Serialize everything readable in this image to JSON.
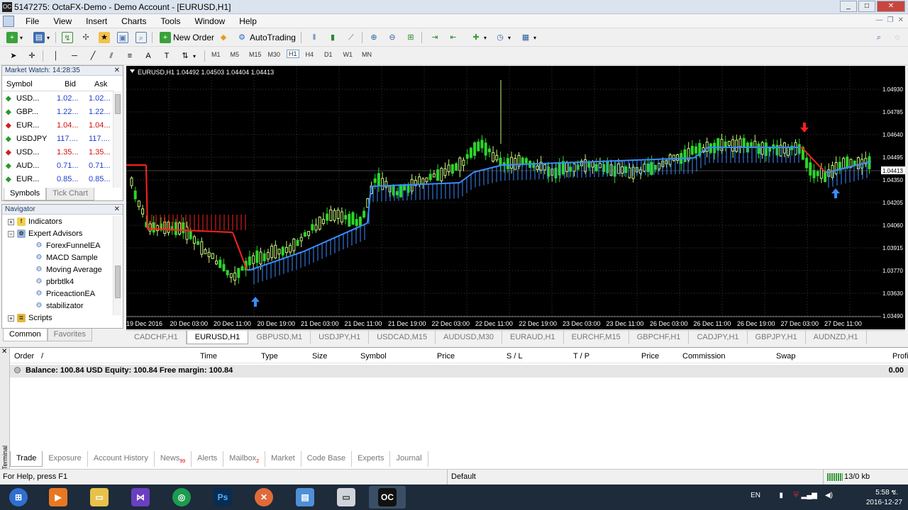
{
  "window": {
    "title": "5147275: OctaFX-Demo - Demo Account - [EURUSD,H1]",
    "app_icon": "OC",
    "min": "_",
    "max": "□",
    "close": "✕"
  },
  "menu": [
    "File",
    "View",
    "Insert",
    "Charts",
    "Tools",
    "Window",
    "Help"
  ],
  "toolbar": {
    "new_order": "New Order",
    "autotrading": "AutoTrading"
  },
  "timeframes": [
    "M1",
    "M5",
    "M15",
    "M30",
    "H1",
    "H4",
    "D1",
    "W1",
    "MN"
  ],
  "active_timeframe": "H1",
  "market_watch": {
    "title": "Market Watch: 14:28:35",
    "headers": [
      "Symbol",
      "Bid",
      "Ask"
    ],
    "rows": [
      {
        "dir": "up",
        "symbol": "USD...",
        "bid": "1.02...",
        "ask": "1.02...",
        "color": "#1f3fd0"
      },
      {
        "dir": "up",
        "symbol": "GBP...",
        "bid": "1.22...",
        "ask": "1.22...",
        "color": "#1f3fd0"
      },
      {
        "dir": "down",
        "symbol": "EUR...",
        "bid": "1.04...",
        "ask": "1.04...",
        "color": "#d01010"
      },
      {
        "dir": "up",
        "symbol": "USDJPY",
        "bid": "117....",
        "ask": "117....",
        "color": "#1f3fd0"
      },
      {
        "dir": "down",
        "symbol": "USD...",
        "bid": "1.35...",
        "ask": "1.35...",
        "color": "#d01010"
      },
      {
        "dir": "up",
        "symbol": "AUD...",
        "bid": "0.71...",
        "ask": "0.71...",
        "color": "#1f3fd0"
      },
      {
        "dir": "up",
        "symbol": "EUR...",
        "bid": "0.85...",
        "ask": "0.85...",
        "color": "#1f3fd0"
      }
    ],
    "tabs": [
      "Symbols",
      "Tick Chart"
    ]
  },
  "navigator": {
    "title": "Navigator",
    "items": [
      "Indicators",
      "Expert Advisors",
      "ForexFunnelEA",
      "MACD Sample",
      "Moving Average",
      "pbrbtlk4",
      "PriceactionEA",
      "stabilizator",
      "Scripts"
    ],
    "tabs": [
      "Common",
      "Favorites"
    ]
  },
  "chart": {
    "header": "EURUSD,H1  1.04492 1.04503 1.04404 1.04413",
    "price_labels": [
      "1.04930",
      "1.04785",
      "1.04640",
      "1.04495",
      "1.04413",
      "1.04350",
      "1.04205",
      "1.04060",
      "1.03915",
      "1.03770",
      "1.03630",
      "1.03490"
    ],
    "time_labels": [
      "19 Dec 2016",
      "20 Dec 03:00",
      "20 Dec 11:00",
      "20 Dec 19:00",
      "21 Dec 03:00",
      "21 Dec 11:00",
      "21 Dec 19:00",
      "22 Dec 03:00",
      "22 Dec 11:00",
      "22 Dec 19:00",
      "23 Dec 03:00",
      "23 Dec 11:00",
      "26 Dec 03:00",
      "26 Dec 11:00",
      "26 Dec 19:00",
      "27 Dec 03:00",
      "27 Dec 11:00"
    ]
  },
  "chart_tabs": [
    "CADCHF,H1",
    "EURUSD,H1",
    "GBPUSD,M1",
    "USDJPY,H1",
    "USDCAD,M15",
    "AUDUSD,M30",
    "EURAUD,H1",
    "EURCHF,M15",
    "GBPCHF,H1",
    "CADJPY,H1",
    "GBPJPY,H1",
    "AUDNZD,H1"
  ],
  "active_chart_tab": "EURUSD,H1",
  "terminal": {
    "side_label": "Terminal",
    "columns": [
      "Order",
      "/",
      "Time",
      "Type",
      "Size",
      "Symbol",
      "Price",
      "S / L",
      "T / P",
      "Price",
      "Commission",
      "Swap",
      "Profit"
    ],
    "balance_text": "Balance: 100.84 USD  Equity: 100.84  Free margin: 100.84",
    "profit": "0.00",
    "tabs": [
      {
        "label": "Trade",
        "badge": ""
      },
      {
        "label": "Exposure",
        "badge": ""
      },
      {
        "label": "Account History",
        "badge": ""
      },
      {
        "label": "News",
        "badge": "99"
      },
      {
        "label": "Alerts",
        "badge": ""
      },
      {
        "label": "Mailbox",
        "badge": "2"
      },
      {
        "label": "Market",
        "badge": ""
      },
      {
        "label": "Code Base",
        "badge": ""
      },
      {
        "label": "Experts",
        "badge": ""
      },
      {
        "label": "Journal",
        "badge": ""
      }
    ]
  },
  "status": {
    "help": "For Help, press F1",
    "profile": "Default",
    "traffic": "13/0 kb"
  },
  "taskbar": {
    "lang": "EN",
    "time": "5:58 ช.",
    "date": "2016-12-27"
  },
  "colors": {
    "up_candle": "#c8f57a",
    "down_candle": "#2bd62b",
    "stop_up": "#3b8cff",
    "stop_down": "#ff2020"
  }
}
